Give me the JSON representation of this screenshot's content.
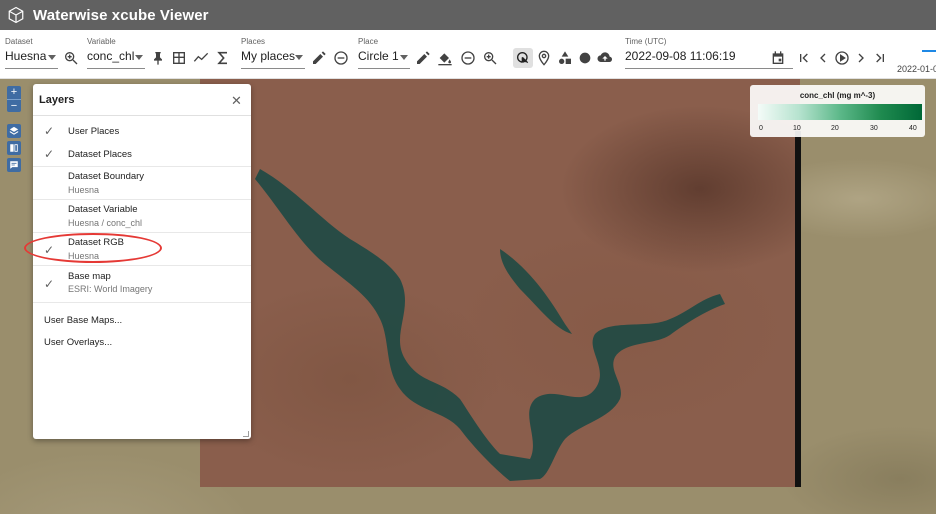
{
  "app": {
    "title": "Waterwise xcube Viewer",
    "logo_icon": "cube-icon"
  },
  "toolbar": {
    "dataset": {
      "label": "Dataset",
      "value": "Huesna"
    },
    "variable": {
      "label": "Variable",
      "value": "conc_chl"
    },
    "places": {
      "label": "Places",
      "value": "My places"
    },
    "place": {
      "label": "Place",
      "value": "Circle 1"
    },
    "time": {
      "label": "Time (UTC)",
      "value": "2022-09-08 11:06:19"
    },
    "edge_date": "2022-01-0"
  },
  "legend": {
    "title": "conc_chl (mg m^-3)",
    "ticks": [
      "0",
      "10",
      "20",
      "30",
      "40"
    ],
    "colors": [
      "#f4fbf8",
      "#b6e3cf",
      "#5cb889",
      "#1f8a4f",
      "#006837"
    ]
  },
  "layers_panel": {
    "title": "Layers",
    "items": [
      {
        "primary": "User Places",
        "secondary": "",
        "checked": true
      },
      {
        "primary": "Dataset Places",
        "secondary": "",
        "checked": true
      },
      {
        "primary": "Dataset Boundary",
        "secondary": "Huesna",
        "checked": false
      },
      {
        "primary": "Dataset Variable",
        "secondary": "Huesna / conc_chl",
        "checked": false
      },
      {
        "primary": "Dataset RGB",
        "secondary": "Huesna",
        "checked": true
      },
      {
        "primary": "Base map",
        "secondary": "ESRI: World Imagery",
        "checked": true
      }
    ],
    "links": [
      "User Base Maps...",
      "User Overlays..."
    ]
  },
  "zoom": {
    "in": "+",
    "out": "−"
  }
}
